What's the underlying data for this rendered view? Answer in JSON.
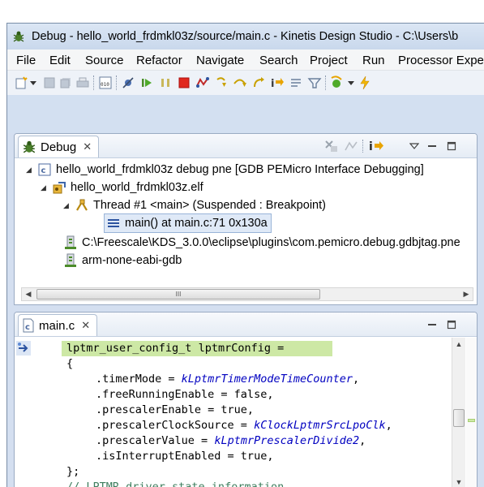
{
  "window": {
    "title": "Debug - hello_world_frdmkl03z/source/main.c - Kinetis Design Studio - C:\\Users\\b"
  },
  "menu": [
    "File",
    "Edit",
    "Source",
    "Refactor",
    "Navigate",
    "Search",
    "Project",
    "Run",
    "Processor Exper"
  ],
  "debug_view": {
    "tab_label": "Debug",
    "tree": [
      {
        "label": "hello_world_frdmkl03z debug pne [GDB PEMicro Interface Debugging]",
        "icon": "launch-config-icon",
        "expanded": true
      },
      {
        "label": "hello_world_frdmkl03z.elf",
        "icon": "debug-target-icon",
        "expanded": true
      },
      {
        "label": "Thread #1 <main> (Suspended : Breakpoint)",
        "icon": "thread-icon",
        "expanded": true
      },
      {
        "label": "main() at main.c:71 0x130a",
        "icon": "stack-frame-icon",
        "selected": true
      },
      {
        "label": "C:\\Freescale\\KDS_3.0.0\\eclipse\\plugins\\com.pemicro.debug.gdbjtag.pne",
        "icon": "process-icon"
      },
      {
        "label": "arm-none-eabi-gdb",
        "icon": "process-icon"
      }
    ],
    "scroll_thumb_grip": "III"
  },
  "editor": {
    "tab_label": "main.c",
    "code": {
      "line1": {
        "type": "lptmr_user_config_t",
        "name": "lptmrConfig",
        "op": "="
      },
      "line2": "{",
      "line3": {
        "field": ".timerMode = ",
        "enum": "kLptmrTimerModeTimeCounter",
        "end": ","
      },
      "line4": {
        "field": ".freeRunningEnable = false,"
      },
      "line5": {
        "field": ".prescalerEnable = true,"
      },
      "line6": {
        "field": ".prescalerClockSource = ",
        "enum": "kClockLptmrSrcLpoClk",
        "end": ","
      },
      "line7": {
        "field": ".prescalerValue = ",
        "enum": "kLptmrPrescalerDivide2",
        "end": ","
      },
      "line8": {
        "field": ".isInterruptEnabled = true,"
      },
      "line9": "};",
      "line10": "// LPTMR driver state information"
    }
  },
  "colors": {
    "current_line_highlight": "#cde8a5",
    "keyword": "#7f0055",
    "enum_constant": "#0000c0",
    "comment": "#3f7f5f",
    "selection_bg": "#dfe9f7"
  }
}
